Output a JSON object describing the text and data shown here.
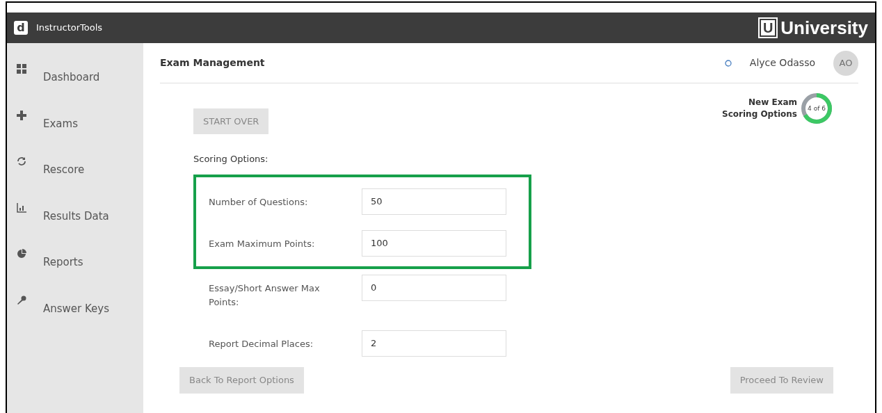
{
  "topbar": {
    "app_name": "InstructorTools",
    "logo_letter": "d",
    "brand_letter": "U",
    "brand": "University"
  },
  "sidebar": {
    "items": [
      {
        "kind": "dashboard",
        "label": "Dashboard"
      },
      {
        "kind": "plus",
        "label": "Exams"
      },
      {
        "kind": "refresh",
        "label": "Rescore"
      },
      {
        "kind": "chart",
        "label": "Results Data"
      },
      {
        "kind": "pie",
        "label": "Reports"
      },
      {
        "kind": "key",
        "label": "Answer Keys"
      }
    ]
  },
  "header": {
    "title": "Exam Management",
    "user": "Alyce Odasso",
    "initials": "AO"
  },
  "progress": {
    "lines": [
      "New Exam",
      "Scoring Options"
    ],
    "reading": "4 of 6",
    "level": 0.667
  },
  "start_over": "START OVER",
  "section_label": "Scoring Options:",
  "fields": [
    {
      "label": "Number of Questions:",
      "value": "50",
      "highlighted": true
    },
    {
      "label": "Exam Maximum Points:",
      "value": "100",
      "highlighted": true
    },
    {
      "label": "Essay/Short Answer Max Points:",
      "value": "0",
      "highlighted": false
    },
    {
      "label": "Report Decimal Places:",
      "value": "2",
      "highlighted": false
    }
  ],
  "buttons": {
    "back": "Back To Report Options",
    "next": "Proceed To Review"
  }
}
